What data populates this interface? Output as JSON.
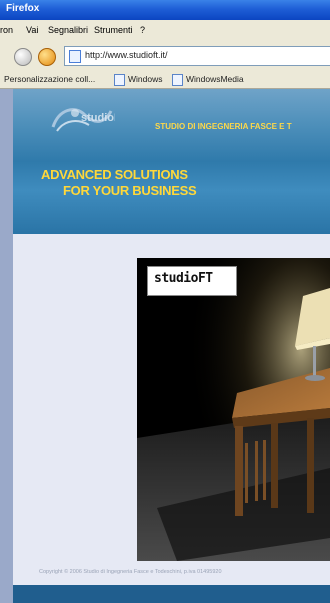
{
  "window": {
    "title": "Firefox"
  },
  "menu": {
    "items": [
      "ron",
      "Vai",
      "Segnalibri",
      "Strumenti",
      "?"
    ]
  },
  "address": {
    "url": "http://www.studioft.it/"
  },
  "bookmarks": {
    "items": [
      "Personalizzazione coll...",
      "Windows",
      "WindowsMedia"
    ]
  },
  "site": {
    "logo_text": "studioFT",
    "tagline": "STUDIO DI INGEGNERIA FASCE E T",
    "headline_1": "ADVANCED SOLUTIONS",
    "headline_2": "FOR YOUR BUSINESS",
    "photo_logo": "studioFT",
    "copyright": "Copyright © 2006 Studio di Ingegneria Fasce e Todeschini, p.iva 01495920"
  },
  "colors": {
    "accent_yellow": "#ffd83a",
    "header_blue": "#2f7aab",
    "title_blue": "#0b45c1"
  }
}
